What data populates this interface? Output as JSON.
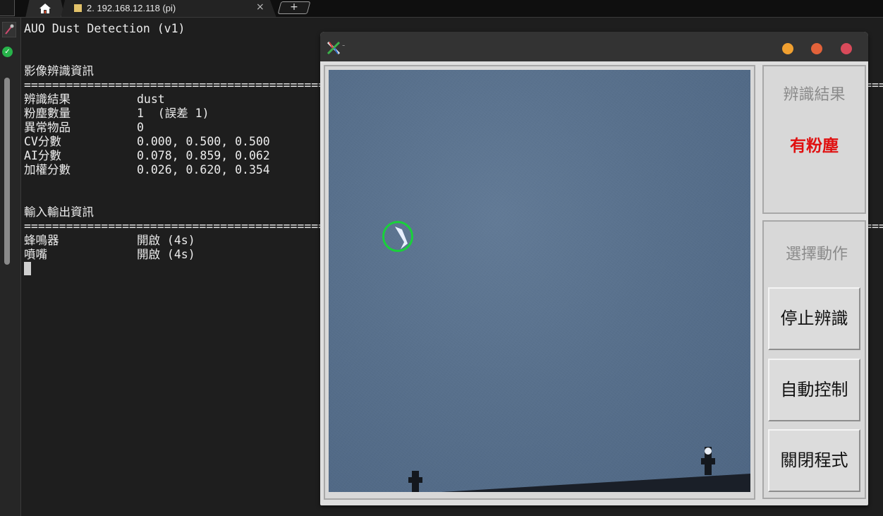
{
  "tabbar": {
    "session_title": "2. 192.168.12.118 (pi)",
    "close_glyph": "×",
    "new_tab_glyph": "+"
  },
  "terminal": {
    "header": "AUO Dust Detection (v1)",
    "section1_title": "影像辨識資訊",
    "rule": "====================================================================================================================================================================================",
    "recognition": [
      {
        "label": "辨識結果",
        "value": "dust"
      },
      {
        "label": "粉塵數量",
        "value": "1  (誤差 1)"
      },
      {
        "label": "異常物品",
        "value": "0"
      },
      {
        "label": "CV分數",
        "value": "0.000, 0.500, 0.500"
      },
      {
        "label": "AI分數",
        "value": "0.078, 0.859, 0.062"
      },
      {
        "label": "加權分數",
        "value": "0.026, 0.620, 0.354"
      }
    ],
    "section2_title": "輸入輸出資訊",
    "io": [
      {
        "label": "蜂鳴器",
        "value": "開啟 (4s)"
      },
      {
        "label": "噴嘴",
        "value": "開啟 (4s)"
      }
    ]
  },
  "xwindow": {
    "title_dash": "-",
    "result_title": "辨識結果",
    "result_value": "有粉塵",
    "action_title": "選擇動作",
    "btn_stop": "停止辨識",
    "btn_auto": "自動控制",
    "btn_close": "關閉程式",
    "colors": {
      "result_red": "#e01010",
      "detect_green": "#19d13a"
    }
  }
}
